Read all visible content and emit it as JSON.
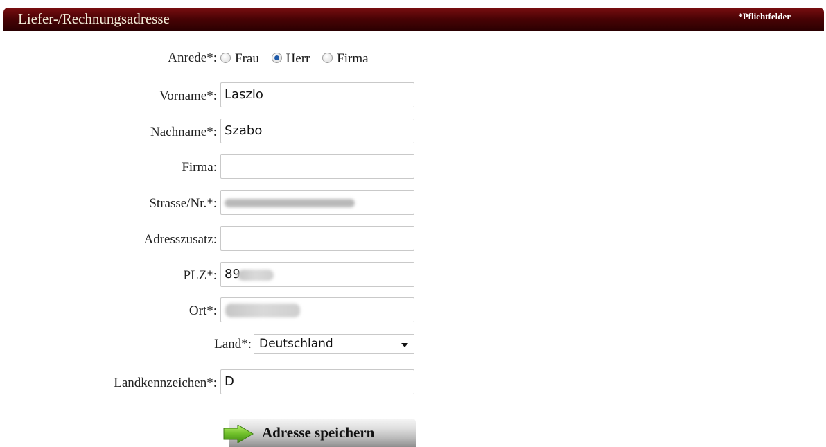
{
  "header": {
    "title": "Liefer-/Rechnungsadresse",
    "required_note": "*Pflichtfelder"
  },
  "form": {
    "salutation": {
      "label": "Anrede*:",
      "options": [
        {
          "label": "Frau",
          "checked": false
        },
        {
          "label": "Herr",
          "checked": true
        },
        {
          "label": "Firma",
          "checked": false
        }
      ]
    },
    "first_name": {
      "label": "Vorname*:",
      "value": "Laszlo"
    },
    "last_name": {
      "label": "Nachname*:",
      "value": "Szabo"
    },
    "company": {
      "label": "Firma:",
      "value": ""
    },
    "street": {
      "label": "Strasse/Nr.*:",
      "value": ""
    },
    "address_extra": {
      "label": "Adresszusatz:",
      "value": ""
    },
    "zip": {
      "label": "PLZ*:",
      "value": "89"
    },
    "city": {
      "label": "Ort*:",
      "value": ""
    },
    "country": {
      "label": "Land*:",
      "value": "Deutschland"
    },
    "country_code": {
      "label": "Landkennzeichen*:",
      "value": "D"
    },
    "save_label": "Adresse speichern"
  },
  "icons": {
    "save": "arrow-right-icon",
    "dropdown": "chevron-down-icon"
  },
  "colors": {
    "header": "#4b0305",
    "radio_selected": "#1f5aa8",
    "arrow": "#6fbf2a"
  }
}
